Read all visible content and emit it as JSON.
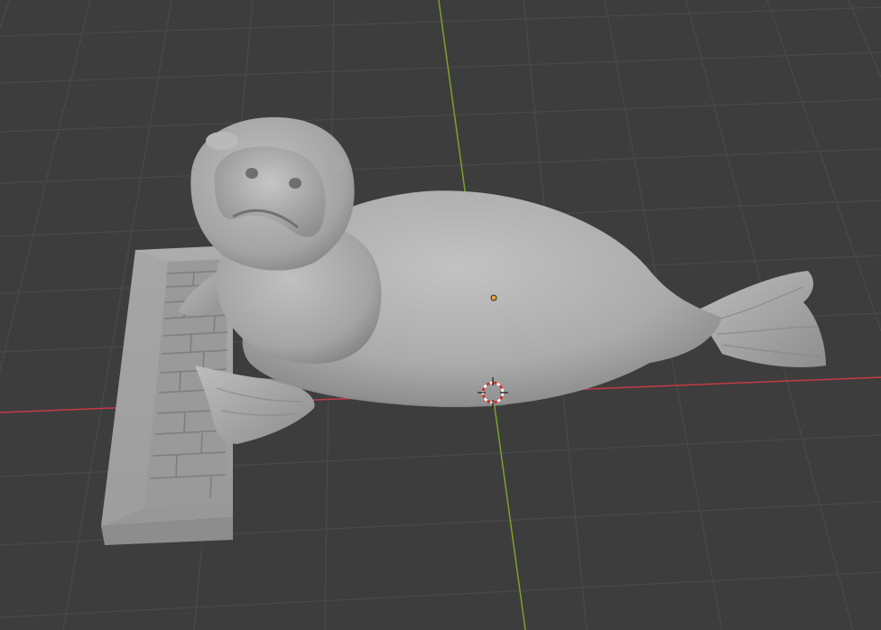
{
  "viewport": {
    "mode": "3d-viewport",
    "shading": "solid",
    "background_color": "#3d3d3d",
    "grid_color": "#4a4a4a",
    "x_axis_color": "#c23a45",
    "y_axis_color": "#7ba32a",
    "mesh_color": "#b4b4b4",
    "origin_color": "#f0a030"
  },
  "scene": {
    "objects": [
      {
        "name": "seal",
        "icon": "seal-mesh-icon",
        "selected": false
      },
      {
        "name": "base",
        "icon": "keyboard-base-icon",
        "selected": false
      }
    ],
    "cursor": {
      "icon": "3d-cursor-icon"
    }
  }
}
